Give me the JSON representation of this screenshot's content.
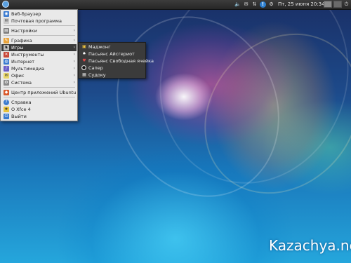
{
  "panel": {
    "clock": "Пт, 25 июня  20:34",
    "tray_icons": [
      "volume-icon",
      "mail-icon",
      "network-icon",
      "info-icon",
      "power-icon"
    ]
  },
  "menu": {
    "items": [
      {
        "label": "Веб-браузер",
        "icon": "globe-icon",
        "has_submenu": false
      },
      {
        "label": "Почтовая программа",
        "icon": "mail-icon",
        "has_submenu": false
      },
      {
        "label": "Настройки",
        "icon": "settings-icon",
        "has_submenu": true
      },
      {
        "label": "Графика",
        "icon": "graphics-icon",
        "has_submenu": true
      },
      {
        "label": "Игры",
        "icon": "games-icon",
        "has_submenu": true
      },
      {
        "label": "Инструменты",
        "icon": "tools-icon",
        "has_submenu": true
      },
      {
        "label": "Интернет",
        "icon": "internet-icon",
        "has_submenu": true
      },
      {
        "label": "Мультимедиа",
        "icon": "multimedia-icon",
        "has_submenu": true
      },
      {
        "label": "Офис",
        "icon": "office-icon",
        "has_submenu": true
      },
      {
        "label": "Система",
        "icon": "system-icon",
        "has_submenu": true
      },
      {
        "label": "Центр приложений Ubuntu",
        "icon": "software-center-icon",
        "has_submenu": false
      },
      {
        "label": "Справка",
        "icon": "help-icon",
        "has_submenu": false
      },
      {
        "label": "О Xfce 4",
        "icon": "about-icon",
        "has_submenu": false
      },
      {
        "label": "Выйти",
        "icon": "logout-icon",
        "has_submenu": false
      }
    ],
    "active_item": "Игры"
  },
  "submenu": {
    "items": [
      {
        "label": "Маджонг",
        "icon": "mahjongg-icon"
      },
      {
        "label": "Пасьянс Айсгериот",
        "icon": "cards-icon"
      },
      {
        "label": "Пасьянс Свободная ячейка",
        "icon": "freecell-icon"
      },
      {
        "label": "Сапер",
        "icon": "mines-icon"
      },
      {
        "label": "Судоку",
        "icon": "sudoku-icon"
      }
    ]
  },
  "watermark": "Kazachya.net"
}
